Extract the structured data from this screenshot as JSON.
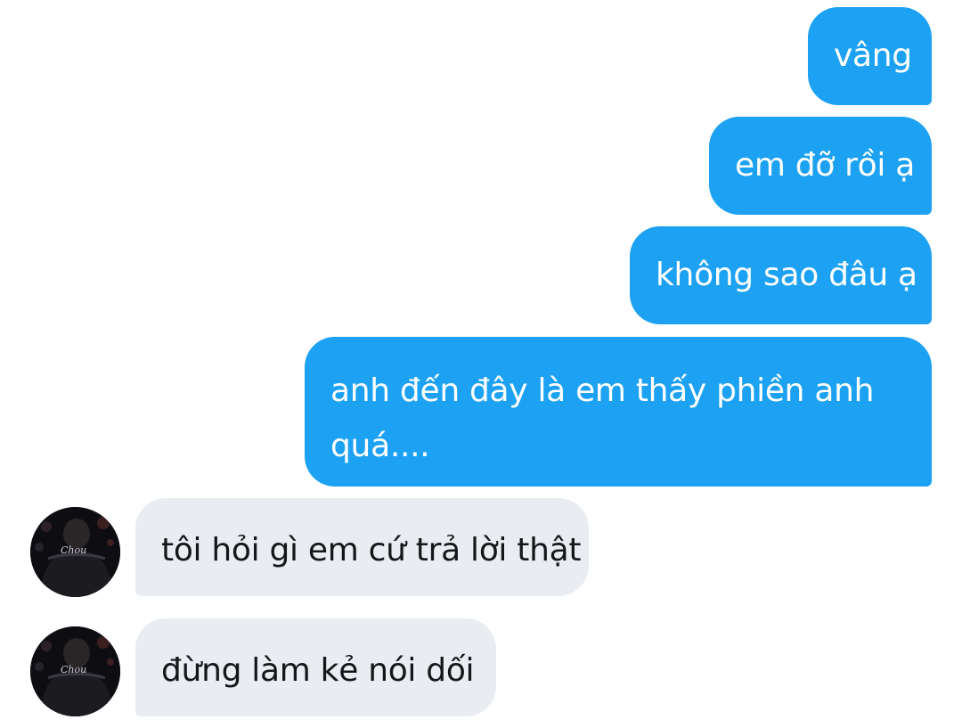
{
  "conversation": {
    "messages": [
      {
        "direction": "sent",
        "text": "vâng"
      },
      {
        "direction": "sent",
        "text": "em đỡ rồi ạ"
      },
      {
        "direction": "sent",
        "text": "không sao đâu ạ"
      },
      {
        "direction": "sent",
        "text": "anh đến đây là em thấy phiền anh quá...."
      },
      {
        "direction": "received",
        "text": "tôi hỏi gì em cứ trả lời thật"
      },
      {
        "direction": "received",
        "text": "đừng làm kẻ nói dối"
      }
    ],
    "avatar_jersey_text": "Chou",
    "colors": {
      "sent_bubble": "#1da1f2",
      "sent_text": "#ffffff",
      "received_bubble": "#e9ecf0",
      "received_text": "#141619",
      "background": "#ffffff"
    }
  }
}
